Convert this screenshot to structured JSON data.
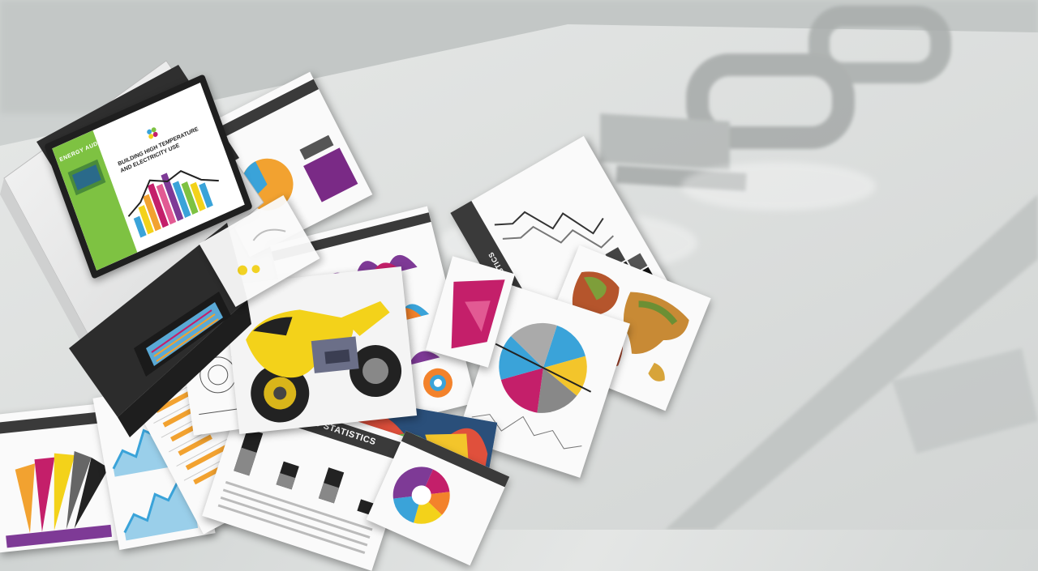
{
  "scene": {
    "description_free": true,
    "colors": {
      "background": "#d9dcdb",
      "printer_body": "#e9eaea",
      "printer_dark": "#2c2c2c",
      "screen_green": "#7ec242",
      "moto_yellow": "#f3d21a",
      "accent_magenta": "#c41f6a",
      "accent_blue": "#3aa3d9"
    }
  },
  "printer_screen": {
    "heading_line1": "BUILDING HIGH TEMPERATURE",
    "heading_line2": "AND ELECTRICITY USE",
    "side_label": "ENERGY AUDIT REPORT"
  },
  "docs": {
    "portfolio_label_1": "PORTFOLIO STATISTICS",
    "portfolio_label_2": "PORTFOLIO STATISTICS"
  }
}
